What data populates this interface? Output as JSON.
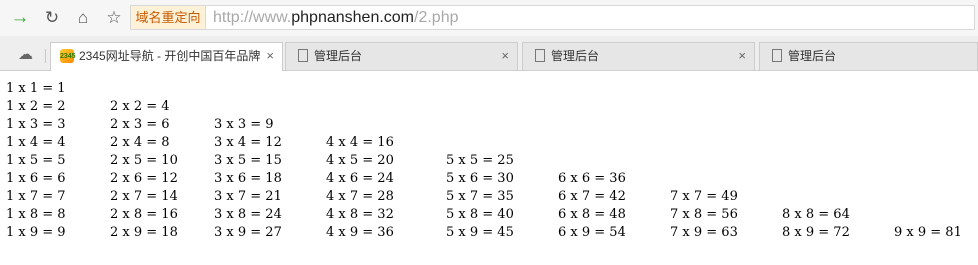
{
  "toolbar": {
    "redirect_badge": "域名重定向",
    "url_prefix": "http://www.",
    "url_domain": "phpnanshen.com",
    "url_path": "/2.php"
  },
  "tabs": [
    {
      "label": "2345网址导航 - 开创中国百年品牌",
      "icon": "2345-logo-icon",
      "active": true,
      "close": "×"
    },
    {
      "label": "管理后台",
      "icon": "page-icon",
      "active": false,
      "close": "×"
    },
    {
      "label": "管理后台",
      "icon": "page-icon",
      "active": false,
      "close": "×"
    },
    {
      "label": "管理后台",
      "icon": "page-icon",
      "active": false,
      "close": ""
    }
  ],
  "logo_text": "2345",
  "multiplication_table": [
    [
      "1 x 1 = 1"
    ],
    [
      "1 x 2 = 2",
      "2 x 2 = 4"
    ],
    [
      "1 x 3 = 3",
      "2 x 3 = 6",
      "3 x 3 = 9"
    ],
    [
      "1 x 4 = 4",
      "2 x 4 = 8",
      "3 x 4 = 12",
      "4 x 4 = 16"
    ],
    [
      "1 x 5 = 5",
      "2 x 5 = 10",
      "3 x 5 = 15",
      "4 x 5 = 20",
      "5 x 5 = 25"
    ],
    [
      "1 x 6 = 6",
      "2 x 6 = 12",
      "3 x 6 = 18",
      "4 x 6 = 24",
      "5 x 6 = 30",
      "6 x 6 = 36"
    ],
    [
      "1 x 7 = 7",
      "2 x 7 = 14",
      "3 x 7 = 21",
      "4 x 7 = 28",
      "5 x 7 = 35",
      "6 x 7 = 42",
      "7 x 7 = 49"
    ],
    [
      "1 x 8 = 8",
      "2 x 8 = 16",
      "3 x 8 = 24",
      "4 x 8 = 32",
      "5 x 8 = 40",
      "6 x 8 = 48",
      "7 x 8 = 56",
      "8 x 8 = 64"
    ],
    [
      "1 x 9 = 9",
      "2 x 9 = 18",
      "3 x 9 = 27",
      "4 x 9 = 36",
      "5 x 9 = 45",
      "6 x 9 = 54",
      "7 x 9 = 63",
      "8 x 9 = 72",
      "9 x 9 = 81"
    ]
  ]
}
